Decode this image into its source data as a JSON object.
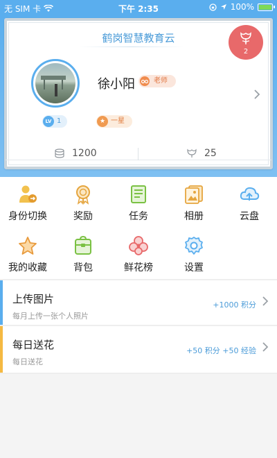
{
  "status_bar": {
    "carrier": "无 SIM 卡",
    "time": "下午 2:35",
    "battery": "100%"
  },
  "profile": {
    "school": "鹤岗智慧教育云",
    "name": "徐小阳",
    "role": "老师",
    "level_icon": "LV",
    "level": "1",
    "star_rank": "一星",
    "points": "1200",
    "flowers": "25",
    "flower_badge_count": "2"
  },
  "menu": {
    "items": [
      {
        "label": "身份切换",
        "icon": "switch-identity-icon"
      },
      {
        "label": "奖励",
        "icon": "award-medal-icon"
      },
      {
        "label": "任务",
        "icon": "task-list-icon"
      },
      {
        "label": "相册",
        "icon": "photo-album-icon"
      },
      {
        "label": "云盘",
        "icon": "cloud-upload-icon"
      },
      {
        "label": "我的收藏",
        "icon": "star-icon"
      },
      {
        "label": "背包",
        "icon": "backpack-icon"
      },
      {
        "label": "鲜花榜",
        "icon": "flower-icon"
      },
      {
        "label": "设置",
        "icon": "gear-icon"
      }
    ]
  },
  "tasks": [
    {
      "title": "上传图片",
      "desc": "每月上传一张个人照片",
      "reward": "+1000 积分",
      "stripe_color": "#5aaeee"
    },
    {
      "title": "每日送花",
      "desc": "每日送花",
      "reward": "+50 积分 +50 经验",
      "stripe_color": "#f5b942"
    }
  ],
  "colors": {
    "accent": "#5aaeee",
    "flower_badge": "#e8696a",
    "role_tag": "#f08c4e"
  }
}
